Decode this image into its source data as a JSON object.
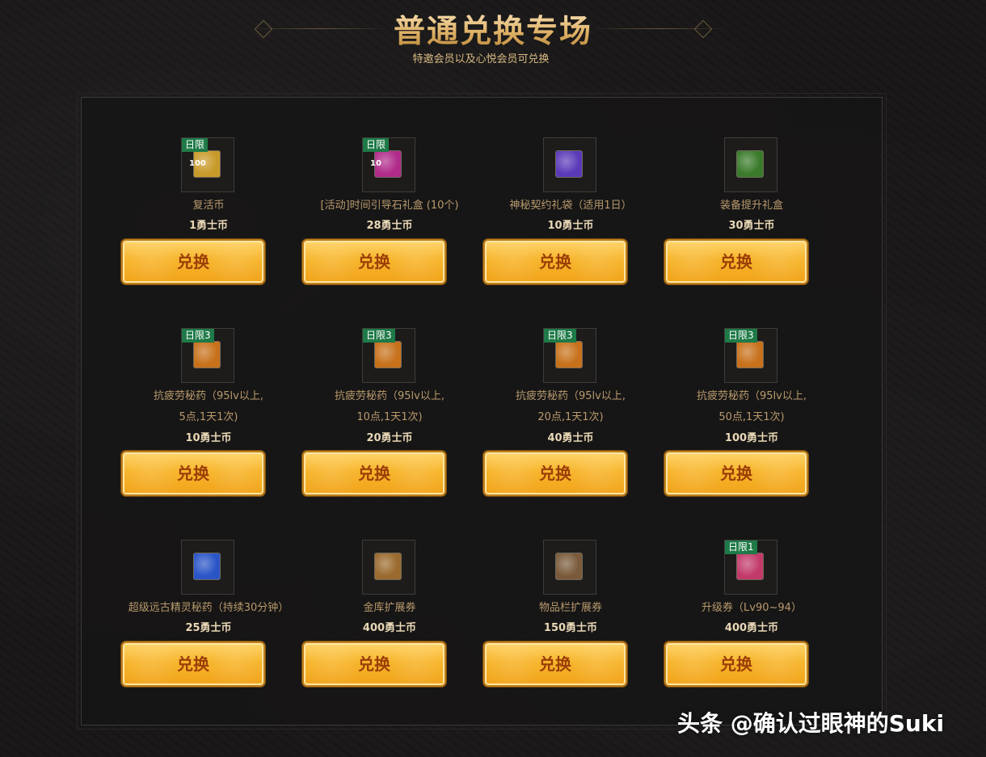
{
  "header": {
    "title": "普通兑换专场",
    "subtitle": "特邀会员以及心悦会员可兑换"
  },
  "button_label": "兑换",
  "items": [
    {
      "badge": "日限",
      "qty": "100",
      "icon": "revive-coin-icon",
      "color": "#c89a2a",
      "name": "复活币",
      "name2": "",
      "price": "1勇士币"
    },
    {
      "badge": "日限",
      "qty": "10",
      "icon": "time-stone-giftbox-icon",
      "color": "#b02b8a",
      "name": "[活动]时间引导石礼盒 (10个)",
      "name2": "",
      "price": "28勇士币"
    },
    {
      "badge": "",
      "qty": "",
      "icon": "mystery-pouch-icon",
      "color": "#5b3ab8",
      "name": "神秘契约礼袋（适用1日）",
      "name2": "",
      "price": "10勇士币"
    },
    {
      "badge": "",
      "qty": "",
      "icon": "gear-upgrade-box-icon",
      "color": "#3a7a2a",
      "name": "装备提升礼盒",
      "name2": "",
      "price": "30勇士币"
    },
    {
      "badge": "日限3",
      "qty": "",
      "icon": "fatigue-potion-icon",
      "color": "#c7711b",
      "name": "抗疲劳秘药（95lv以上,",
      "name2": "5点,1天1次)",
      "price": "10勇士币"
    },
    {
      "badge": "日限3",
      "qty": "",
      "icon": "fatigue-potion-icon",
      "color": "#c7711b",
      "name": "抗疲劳秘药（95lv以上,",
      "name2": "10点,1天1次)",
      "price": "20勇士币"
    },
    {
      "badge": "日限3",
      "qty": "",
      "icon": "fatigue-potion-icon",
      "color": "#c7711b",
      "name": "抗疲劳秘药（95lv以上,",
      "name2": "20点,1天1次)",
      "price": "40勇士币"
    },
    {
      "badge": "日限3",
      "qty": "",
      "icon": "fatigue-potion-icon",
      "color": "#c7711b",
      "name": "抗疲劳秘药（95lv以上,",
      "name2": "50点,1天1次)",
      "price": "100勇士币"
    },
    {
      "badge": "",
      "qty": "",
      "icon": "elven-potion-icon",
      "color": "#2a55c7",
      "name": "超级远古精灵秘药（持续30分钟）",
      "name2": "",
      "price": "25勇士币"
    },
    {
      "badge": "",
      "qty": "",
      "icon": "vault-expansion-icon",
      "color": "#9a6a2e",
      "name": "金库扩展券",
      "name2": "",
      "price": "400勇士币"
    },
    {
      "badge": "",
      "qty": "",
      "icon": "inventory-expansion-icon",
      "color": "#7a5a3a",
      "name": "物品栏扩展券",
      "name2": "",
      "price": "150勇士币"
    },
    {
      "badge": "日限1",
      "qty": "",
      "icon": "level-up-ticket-icon",
      "color": "#c23a6a",
      "name": "升级券（Lv90~94）",
      "name2": "",
      "price": "400勇士币"
    }
  ],
  "watermark": "头条 @确认过眼神的Suki"
}
